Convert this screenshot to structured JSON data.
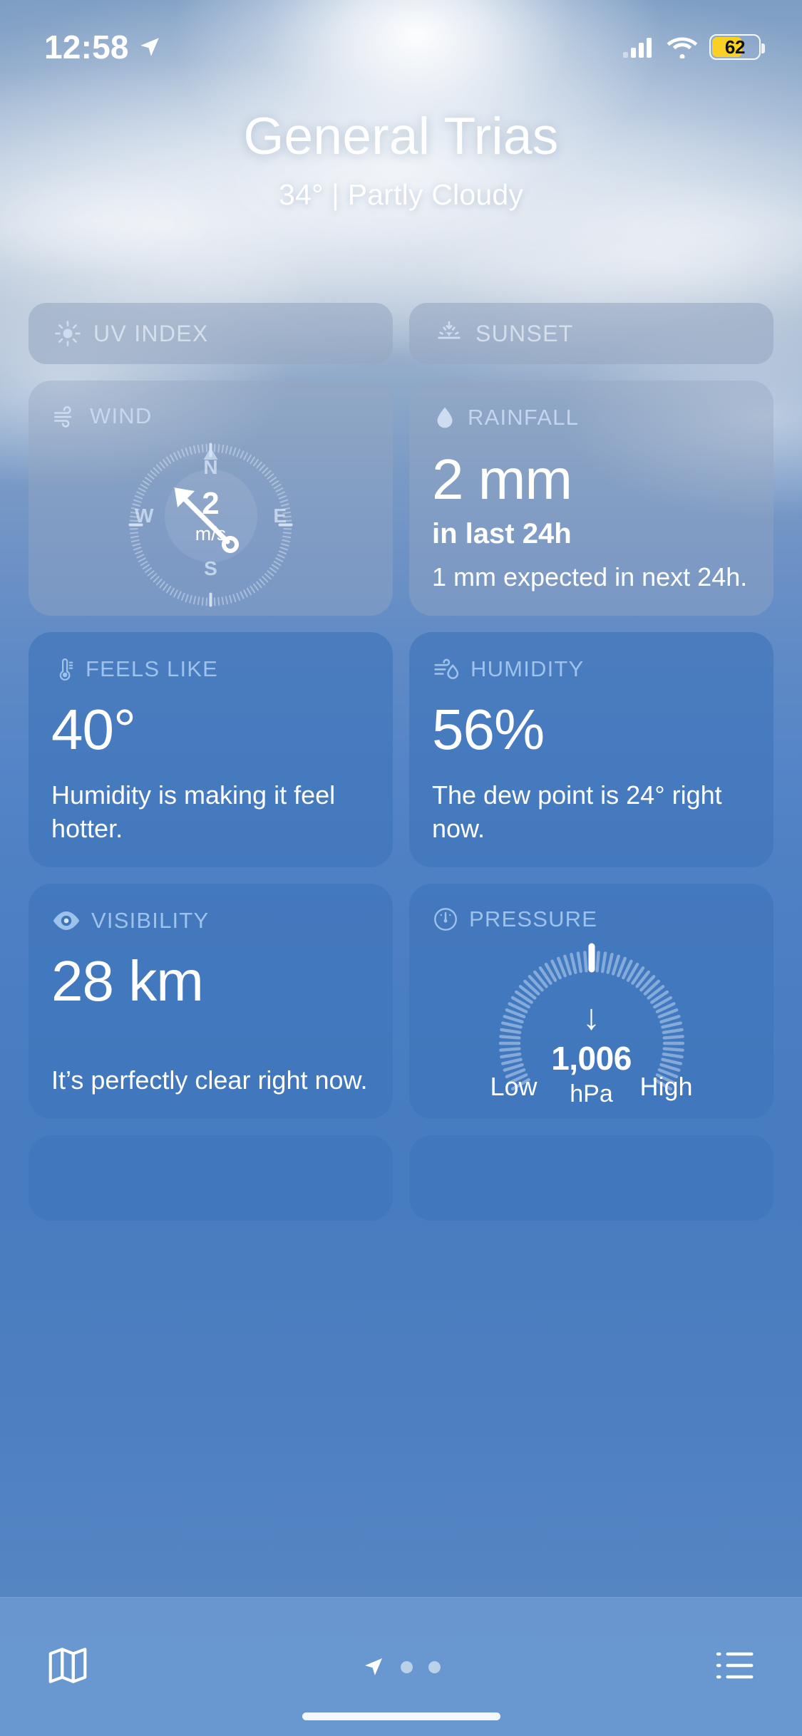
{
  "status_bar": {
    "time": "12:58",
    "location_arrow_icon": "location-arrow-icon",
    "cellular_icon": "cellular-signal-icon",
    "wifi_icon": "wifi-icon",
    "battery_percent": "62"
  },
  "header": {
    "city": "General Trias",
    "condition_line": "34°  |  Partly Cloudy",
    "temperature": "34°",
    "condition": "Partly Cloudy"
  },
  "pills": [
    {
      "label": "UV INDEX",
      "icon": "sun-icon"
    },
    {
      "label": "SUNSET",
      "icon": "sunset-icon"
    }
  ],
  "cards": {
    "wind": {
      "label": "WIND",
      "icon": "wind-icon",
      "value": "2",
      "unit": "m/s",
      "directions": {
        "n": "N",
        "e": "E",
        "s": "S",
        "w": "W"
      },
      "direction_degrees": 315
    },
    "rainfall": {
      "label": "RAINFALL",
      "icon": "raindrop-icon",
      "value": "2 mm",
      "sub": "in last 24h",
      "foot": "1 mm expected in next 24h."
    },
    "feels_like": {
      "label": "FEELS LIKE",
      "icon": "thermometer-icon",
      "value": "40°",
      "foot": "Humidity is making it feel hotter."
    },
    "humidity": {
      "label": "HUMIDITY",
      "icon": "humidity-icon",
      "value": "56%",
      "foot": "The dew point is 24° right now."
    },
    "visibility": {
      "label": "VISIBILITY",
      "icon": "eye-icon",
      "value": "28 km",
      "foot": "It’s perfectly clear right now."
    },
    "pressure": {
      "label": "PRESSURE",
      "icon": "gauge-icon",
      "value": "1,006",
      "unit": "hPa",
      "trend_icon": "arrow-down-icon",
      "low_label": "Low",
      "high_label": "High"
    }
  },
  "tabbar": {
    "map_icon": "map-icon",
    "location_icon": "location-arrow-icon",
    "pages": 3,
    "active_page": 0,
    "list_icon": "list-icon"
  },
  "colors": {
    "battery": "#f8d026",
    "card_solid": "rgba(61,116,186,0.62)",
    "card_glass": "rgba(150,167,193,0.42)",
    "accent_label": "#9dc2ec"
  }
}
